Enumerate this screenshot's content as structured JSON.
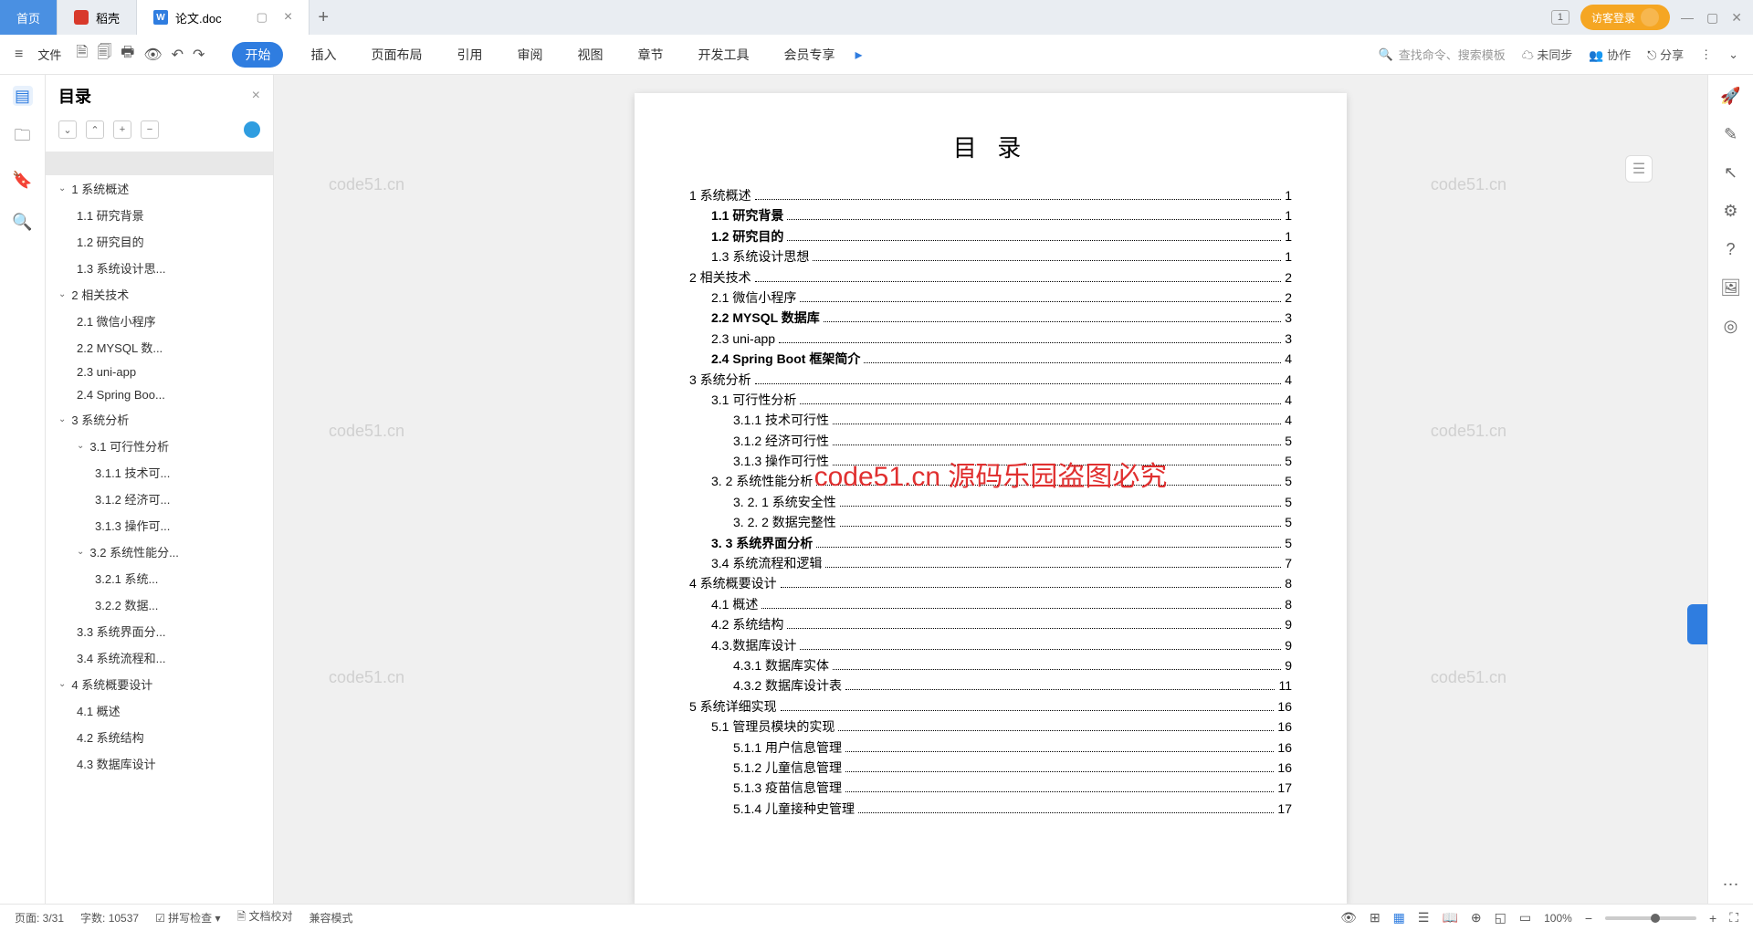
{
  "tabs": {
    "home": "首页",
    "docer": "稻壳",
    "file": "论文.doc"
  },
  "guest": "访客登录",
  "toolbar": {
    "file": "文件"
  },
  "ribbon": [
    "开始",
    "插入",
    "页面布局",
    "引用",
    "审阅",
    "视图",
    "章节",
    "开发工具",
    "会员专享"
  ],
  "search_placeholder": "查找命令、搜索模板",
  "sync": "未同步",
  "collab": "协作",
  "share": "分享",
  "outline": {
    "title": "目录",
    "items": [
      {
        "t": "",
        "l": 0,
        "sel": true
      },
      {
        "t": "1 系统概述",
        "l": 0,
        "c": true
      },
      {
        "t": "1.1 研究背景",
        "l": 1
      },
      {
        "t": "1.2 研究目的",
        "l": 1
      },
      {
        "t": "1.3 系统设计思...",
        "l": 1
      },
      {
        "t": "2 相关技术",
        "l": 0,
        "c": true
      },
      {
        "t": "2.1 微信小程序",
        "l": 1
      },
      {
        "t": "2.2 MYSQL 数...",
        "l": 1
      },
      {
        "t": "2.3 uni-app",
        "l": 1
      },
      {
        "t": "2.4 Spring Boo...",
        "l": 1
      },
      {
        "t": "3 系统分析",
        "l": 0,
        "c": true
      },
      {
        "t": "3.1 可行性分析",
        "l": 1,
        "c": true
      },
      {
        "t": "3.1.1 技术可...",
        "l": 2
      },
      {
        "t": "3.1.2 经济可...",
        "l": 2
      },
      {
        "t": "3.1.3 操作可...",
        "l": 2
      },
      {
        "t": "3.2 系统性能分...",
        "l": 1,
        "c": true
      },
      {
        "t": "3.2.1 系统...",
        "l": 2
      },
      {
        "t": "3.2.2 数据...",
        "l": 2
      },
      {
        "t": "3.3 系统界面分...",
        "l": 1
      },
      {
        "t": "3.4 系统流程和...",
        "l": 1
      },
      {
        "t": "4 系统概要设计",
        "l": 0,
        "c": true
      },
      {
        "t": "4.1 概述",
        "l": 1
      },
      {
        "t": "4.2 系统结构",
        "l": 1
      },
      {
        "t": "4.3 数据库设计",
        "l": 1
      }
    ]
  },
  "doc": {
    "title": "目 录",
    "red_watermark": "code51.cn  源码乐园盗图必究",
    "toc": [
      {
        "t": "1 系统概述",
        "p": "1",
        "i": 0
      },
      {
        "t": "1.1 研究背景",
        "p": "1",
        "i": 1,
        "b": true
      },
      {
        "t": "1.2 研究目的",
        "p": "1",
        "i": 1,
        "b": true
      },
      {
        "t": "1.3 系统设计思想",
        "p": "1",
        "i": 1
      },
      {
        "t": "2 相关技术",
        "p": "2",
        "i": 0
      },
      {
        "t": "2.1 微信小程序",
        "p": "2",
        "i": 1
      },
      {
        "t": "2.2 MYSQL 数据库",
        "p": "3",
        "i": 1,
        "b": true
      },
      {
        "t": "2.3 uni-app",
        "p": "3",
        "i": 1
      },
      {
        "t": "2.4 Spring Boot 框架简介",
        "p": "4",
        "i": 1,
        "b": true
      },
      {
        "t": "3 系统分析",
        "p": "4",
        "i": 0
      },
      {
        "t": "3.1 可行性分析",
        "p": "4",
        "i": 1
      },
      {
        "t": "3.1.1 技术可行性",
        "p": "4",
        "i": 2
      },
      {
        "t": "3.1.2 经济可行性",
        "p": "5",
        "i": 2
      },
      {
        "t": "3.1.3 操作可行性",
        "p": "5",
        "i": 2
      },
      {
        "t": "3. 2 系统性能分析",
        "p": "5",
        "i": 1
      },
      {
        "t": "3. 2. 1 系统安全性",
        "p": "5",
        "i": 2
      },
      {
        "t": "3. 2. 2 数据完整性",
        "p": "5",
        "i": 2
      },
      {
        "t": "3. 3 系统界面分析",
        "p": "5",
        "i": 1,
        "b": true
      },
      {
        "t": "3.4 系统流程和逻辑",
        "p": "7",
        "i": 1
      },
      {
        "t": "4 系统概要设计",
        "p": "8",
        "i": 0
      },
      {
        "t": "4.1 概述",
        "p": "8",
        "i": 1
      },
      {
        "t": "4.2 系统结构",
        "p": "9",
        "i": 1
      },
      {
        "t": "4.3.数据库设计",
        "p": "9",
        "i": 1
      },
      {
        "t": "4.3.1 数据库实体",
        "p": "9",
        "i": 2
      },
      {
        "t": "4.3.2 数据库设计表",
        "p": "11",
        "i": 2
      },
      {
        "t": "5 系统详细实现",
        "p": "16",
        "i": 0
      },
      {
        "t": "5.1 管理员模块的实现",
        "p": "16",
        "i": 1
      },
      {
        "t": "5.1.1 用户信息管理",
        "p": "16",
        "i": 2
      },
      {
        "t": "5.1.2 儿童信息管理",
        "p": "16",
        "i": 2
      },
      {
        "t": "5.1.3 疫苗信息管理",
        "p": "17",
        "i": 2
      },
      {
        "t": "5.1.4 儿童接种史管理",
        "p": "17",
        "i": 2
      }
    ]
  },
  "status": {
    "page": "页面: 3/31",
    "words": "字数: 10537",
    "spell": "拼写检查",
    "review": "文档校对",
    "compat": "兼容模式",
    "zoom": "100%"
  },
  "wm": "code51.cn"
}
